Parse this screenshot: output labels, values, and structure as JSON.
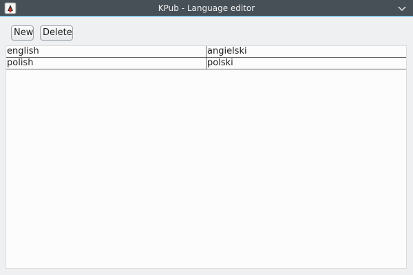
{
  "window": {
    "title": "KPub - Language editor",
    "app_icon": "java-app-icon",
    "menu_icon": "chevron-down-icon",
    "accent_color": "#3daee9",
    "titlebar_color": "#475057"
  },
  "toolbar": {
    "new_label": "New",
    "delete_label": "Delete"
  },
  "table": {
    "rows": [
      {
        "key": "english",
        "value": "angielski"
      },
      {
        "key": "polish",
        "value": "polski"
      }
    ]
  }
}
